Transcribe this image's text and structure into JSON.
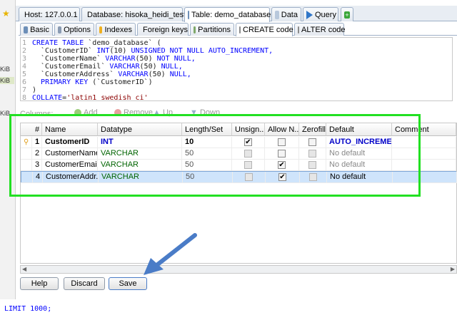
{
  "top_tabs": [
    {
      "label": "Host: 127.0.0.1",
      "icon": "host-icon"
    },
    {
      "label": "Database: hisoka_heidi_test",
      "icon": "database-icon"
    },
    {
      "label": "Table: demo_database",
      "icon": "table-icon"
    },
    {
      "label": "Data",
      "icon": "grid-icon"
    },
    {
      "label": "Query",
      "icon": "play-icon"
    }
  ],
  "side_labels": [
    "KiB",
    "KiB",
    "KiB"
  ],
  "sub_tabs": [
    {
      "label": "Basic",
      "icon": "basic-icon"
    },
    {
      "label": "Options",
      "icon": "wrench-icon"
    },
    {
      "label": "Indexes",
      "icon": "lightning-icon"
    },
    {
      "label": "Foreign keys",
      "icon": "foreign-key-icon"
    },
    {
      "label": "Partitions",
      "icon": "partitions-icon"
    },
    {
      "label": "CREATE code",
      "icon": "create-code-icon"
    },
    {
      "label": "ALTER code",
      "icon": "alter-code-icon"
    }
  ],
  "code": {
    "lines": [
      {
        "n": "1",
        "parts": [
          {
            "t": "CREATE TABLE ",
            "c": "kw"
          },
          {
            "t": "`demo_database` (",
            "c": "txt"
          }
        ]
      },
      {
        "n": "2",
        "parts": [
          {
            "t": "  `CustomerID` ",
            "c": "txt"
          },
          {
            "t": "INT",
            "c": "kw"
          },
          {
            "t": "(10) ",
            "c": "txt"
          },
          {
            "t": "UNSIGNED NOT NULL AUTO_INCREMENT,",
            "c": "kw"
          }
        ]
      },
      {
        "n": "3",
        "parts": [
          {
            "t": "  `CustomerName` ",
            "c": "txt"
          },
          {
            "t": "VARCHAR",
            "c": "kw"
          },
          {
            "t": "(50) ",
            "c": "txt"
          },
          {
            "t": "NOT NULL,",
            "c": "kw"
          }
        ]
      },
      {
        "n": "4",
        "parts": [
          {
            "t": "  `CustomerEmail` ",
            "c": "txt"
          },
          {
            "t": "VARCHAR",
            "c": "kw"
          },
          {
            "t": "(50) ",
            "c": "txt"
          },
          {
            "t": "NULL,",
            "c": "kw"
          }
        ]
      },
      {
        "n": "5",
        "parts": [
          {
            "t": "  `CustomerAddress` ",
            "c": "txt"
          },
          {
            "t": "VARCHAR",
            "c": "kw"
          },
          {
            "t": "(50) ",
            "c": "txt"
          },
          {
            "t": "NULL,",
            "c": "kw"
          }
        ]
      },
      {
        "n": "6",
        "parts": [
          {
            "t": "  ",
            "c": "txt"
          },
          {
            "t": "PRIMARY KEY ",
            "c": "kw"
          },
          {
            "t": "(`CustomerID`)",
            "c": "txt"
          }
        ]
      },
      {
        "n": "7",
        "parts": [
          {
            "t": ")",
            "c": "txt"
          }
        ]
      },
      {
        "n": "8",
        "parts": [
          {
            "t": "COLLATE",
            "c": "kw"
          },
          {
            "t": "=",
            "c": "txt"
          },
          {
            "t": "'latin1_swedish_ci'",
            "c": "str"
          }
        ]
      }
    ]
  },
  "columns_toolbar": {
    "label": "Columns:",
    "add": "Add",
    "remove": "Remove",
    "up": "Up",
    "down": "Down"
  },
  "grid": {
    "headers": [
      "#",
      "Name",
      "Datatype",
      "Length/Set",
      "Unsign...",
      "Allow N...",
      "Zerofill",
      "Default",
      "Comment"
    ],
    "rows": [
      {
        "num": "1",
        "name": "CustomerID",
        "type": "INT",
        "length": "10",
        "unsigned": true,
        "allow_null": false,
        "zerofill": false,
        "default": "AUTO_INCREMENT",
        "primary": true,
        "selected": false
      },
      {
        "num": "2",
        "name": "CustomerName",
        "type": "VARCHAR",
        "length": "50",
        "unsigned": false,
        "allow_null": false,
        "zerofill": false,
        "default": "No default",
        "primary": false,
        "selected": false
      },
      {
        "num": "3",
        "name": "CustomerEmail",
        "type": "VARCHAR",
        "length": "50",
        "unsigned": false,
        "allow_null": true,
        "zerofill": false,
        "default": "No default",
        "primary": false,
        "selected": false
      },
      {
        "num": "4",
        "name": "CustomerAddr...",
        "type": "VARCHAR",
        "length": "50",
        "unsigned": false,
        "allow_null": true,
        "zerofill": false,
        "default": "No default",
        "primary": false,
        "selected": true
      }
    ]
  },
  "buttons": {
    "help": "Help",
    "discard": "Discard",
    "save": "Save"
  },
  "bottom_sql": "LIMIT 1000;",
  "colors": {
    "keyword": "#0000ff",
    "string": "#8b0000",
    "highlight": "#22e022",
    "arrow": "#4a7cc7",
    "selection": "#cfe4fb",
    "key": "#e0a020"
  }
}
